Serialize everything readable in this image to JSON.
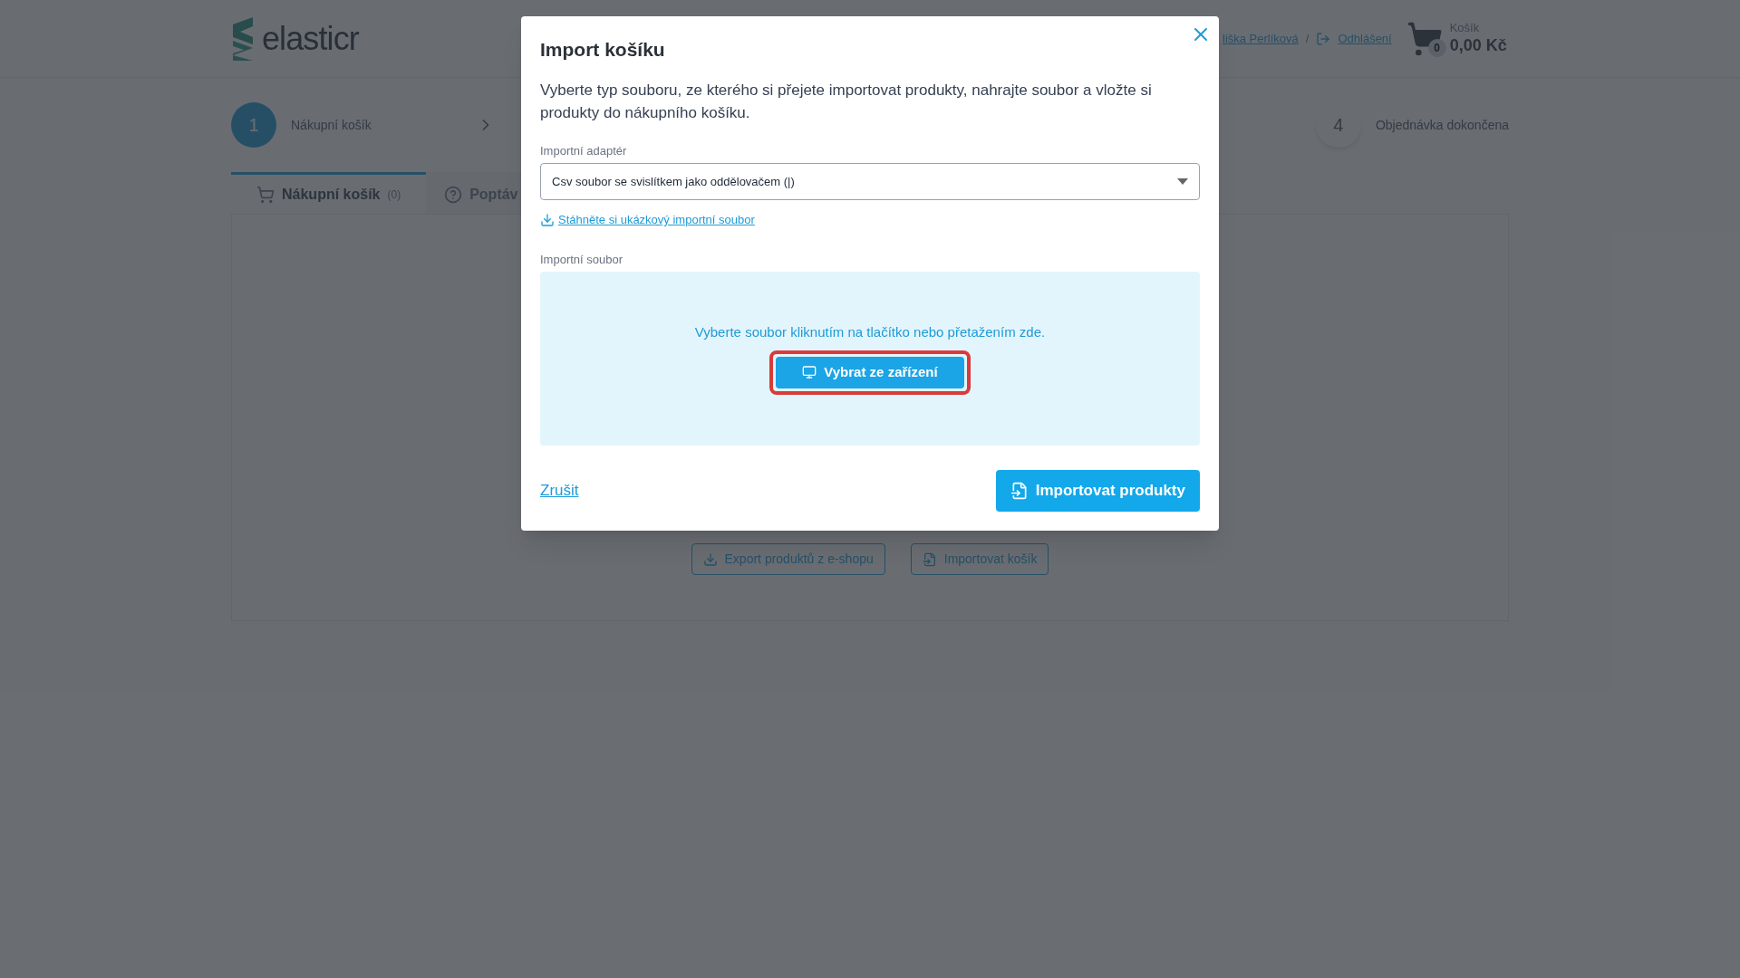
{
  "header": {
    "logo_text": "elasticr",
    "user_link": "liška Perlíková",
    "separator": "/",
    "logout_link": "Odhlášení",
    "cart": {
      "badge": "0",
      "label": "Košík",
      "total": "0,00 Kč"
    }
  },
  "steps": [
    {
      "number": "1",
      "label": "Nákupní košík",
      "selected": true
    },
    {
      "number": "4",
      "label": "Objednávka dokončena",
      "selected": false
    }
  ],
  "tabs": [
    {
      "label": "Nákupní košík",
      "count": "(0)",
      "selected": true
    },
    {
      "label": "Poptáv",
      "selected": false
    }
  ],
  "panel_buttons": [
    {
      "label": "Export produktů z e-shopu"
    },
    {
      "label": "Importovat košík"
    }
  ],
  "modal": {
    "title": "Import košíku",
    "description": "Vyberte typ souboru, ze kterého si přejete importovat produkty, nahrajte soubor a vložte si produkty do nákupního košíku.",
    "adapter": {
      "label": "Importní adaptér",
      "value": "Csv soubor se svislítkem jako oddělovačem (|)"
    },
    "sample_link": "Stáhněte si ukázkový importní soubor",
    "file": {
      "label": "Importní soubor",
      "hint": "Vyberte soubor kliknutím na tlačítko nebo přetažením zde.",
      "button": "Vybrat ze zařízení",
      "highlighted": true
    },
    "cancel": "Zrušit",
    "submit": "Importovat produkty"
  }
}
